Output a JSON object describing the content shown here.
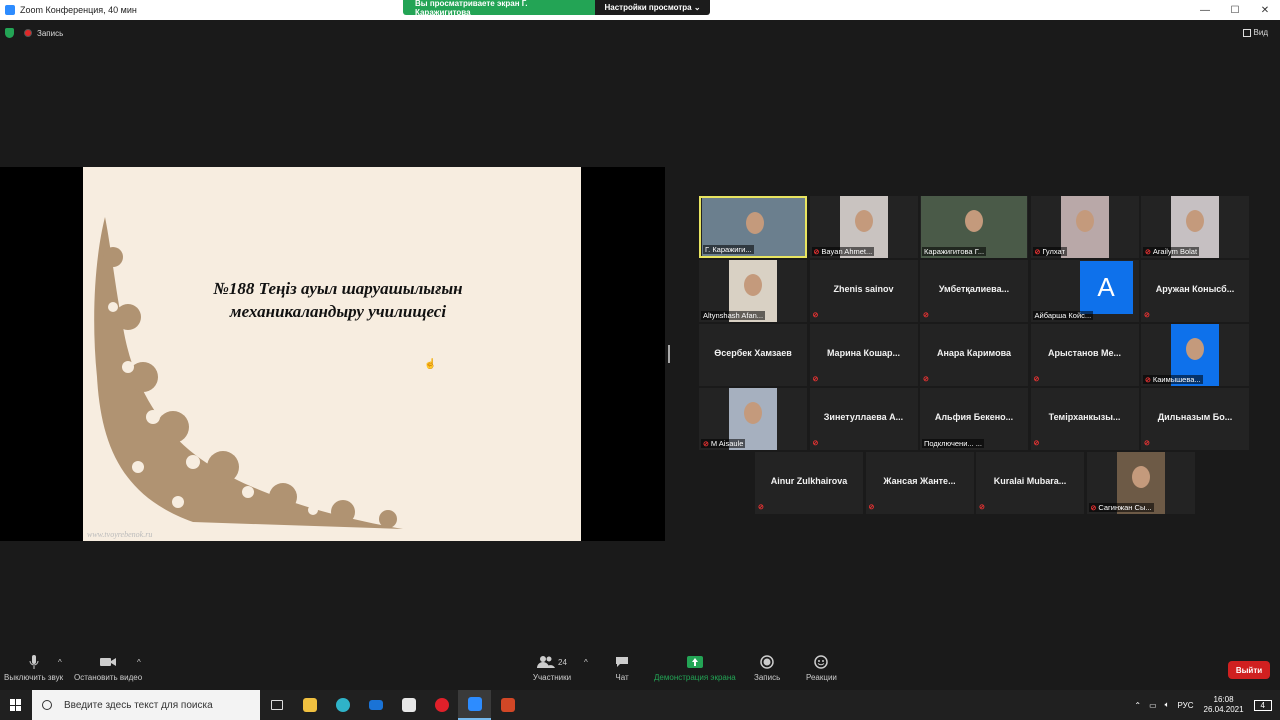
{
  "window": {
    "title": "Zoom Конференция, 40 мин",
    "minimize": "—",
    "maximize": "☐",
    "close": "✕"
  },
  "share_banner": {
    "viewing": "Вы просматриваете экран Г. Каражигитова",
    "view_options": "Настройки просмотра ⌄"
  },
  "topbar": {
    "record_label": "Запись",
    "view_label": "Вид"
  },
  "slide": {
    "title": "№188 Теңіз ауыл шаруашылығын механикаландыру училищесі",
    "watermark": "www.tvoyrebenok.ru"
  },
  "participants": [
    {
      "caption": "Г. Каражиги...",
      "muted": false,
      "video": true,
      "active": true
    },
    {
      "caption": "Bayan Ahmet...",
      "muted": true,
      "video": true
    },
    {
      "caption": "Каражигитова Г...",
      "muted": false,
      "video": true
    },
    {
      "caption": "Гулхат",
      "muted": true,
      "video": true
    },
    {
      "caption": "Arailym Bolat",
      "muted": true,
      "video": true
    },
    {
      "caption": "Altynshash Afan...",
      "muted": false,
      "video": true
    },
    {
      "name": "Zhenis sainov",
      "muted": true
    },
    {
      "name": "Умбетқалиева...",
      "muted": true
    },
    {
      "caption": "Айбарша Койс...",
      "muted": false,
      "avatar_letter": "A"
    },
    {
      "name": "Аружан Конысб...",
      "muted": true
    },
    {
      "name": "Өсербек Хамзаев",
      "muted": false
    },
    {
      "name": "Марина Кошар...",
      "muted": true
    },
    {
      "name": "Анара Каримова",
      "muted": true
    },
    {
      "name": "Арыстанов Ме...",
      "muted": true
    },
    {
      "caption": "Каимышева...",
      "muted": true,
      "video": true
    },
    {
      "caption": "M Aisaule",
      "muted": true,
      "video": true
    },
    {
      "name": "Зинетуллаева А...",
      "muted": true
    },
    {
      "name": "Альфия Бекено...",
      "status": "Подключени... ...",
      "muted": false
    },
    {
      "name": "Темірханкызы...",
      "muted": true
    },
    {
      "name": "Дильназым Бо...",
      "muted": true
    },
    {
      "name": "Ainur Zulkhairova",
      "muted": true
    },
    {
      "name": "Жансая Жанте...",
      "muted": true
    },
    {
      "name": "Kuralai Mubara...",
      "muted": true
    },
    {
      "caption": "Сагинжан Сы...",
      "muted": true,
      "video": true
    }
  ],
  "toolbar": {
    "mute_label": "Выключить звук",
    "video_label": "Остановить видео",
    "participants_label": "Участники",
    "participants_count": "24",
    "chat_label": "Чат",
    "share_label": "Демонстрация экрана",
    "record_label": "Запись",
    "reactions_label": "Реакции",
    "leave_label": "Выйти"
  },
  "taskbar": {
    "search_placeholder": "Введите здесь текст для поиска",
    "lang": "РУС",
    "time": "16:08",
    "date": "26.04.2021",
    "notifications": "4"
  },
  "colors": {
    "green": "#23a455",
    "leave": "#d02020",
    "avatar_blue": "#0e71eb",
    "active_speaker": "#e8e460"
  }
}
